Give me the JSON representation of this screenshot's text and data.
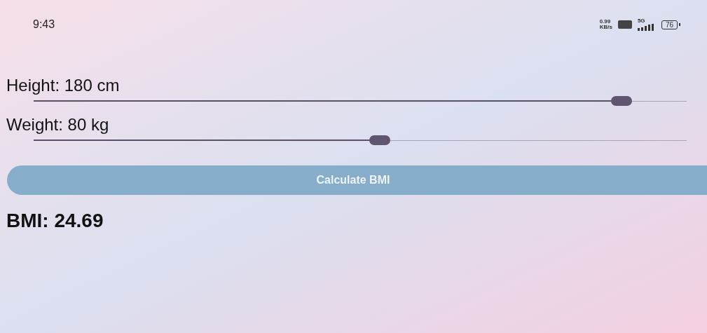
{
  "status_bar": {
    "time": "9:43",
    "net_speed": "0.99",
    "net_unit": "KB/s",
    "network": "5G",
    "battery": "76"
  },
  "sliders": [
    {
      "label": "Height: 180 cm",
      "level": 0.9
    },
    {
      "label": "Weight: 80 kg",
      "level": 0.53
    }
  ],
  "button": {
    "label": "Calculate BMI"
  },
  "result": "BMI: 24.69"
}
